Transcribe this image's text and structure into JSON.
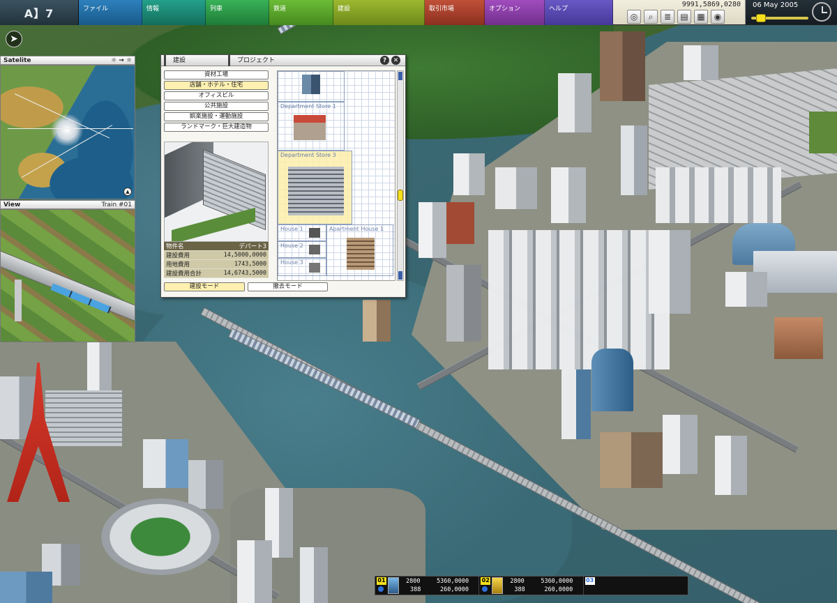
{
  "menubar": {
    "logo": "A】7",
    "items": [
      {
        "label": "ファイル",
        "color": "#1e6ea6"
      },
      {
        "label": "情報",
        "color": "#1a8a74"
      },
      {
        "label": "列車",
        "color": "#2c9c48"
      },
      {
        "label": "鉄道",
        "color": "#5aa82a"
      },
      {
        "label": "建設",
        "color": "#8aa624"
      },
      {
        "label": "取引市場",
        "color": "#a8432c"
      },
      {
        "label": "オプション",
        "color": "#8c3ea6"
      },
      {
        "label": "ヘルプ",
        "color": "#5a48b2"
      }
    ]
  },
  "status": {
    "money": "9991,5869,0280",
    "tools": [
      "planet-icon",
      "zoom-icon",
      "layers-icon",
      "stack-icon",
      "grid-layers-icon",
      "target-icon"
    ],
    "date": "06 May 2005",
    "speed_level": 0.1
  },
  "satellite": {
    "title": "Satelite"
  },
  "view": {
    "title": "View",
    "train": "Train #01"
  },
  "build_window": {
    "tabs": [
      "建設",
      "プロジェクト"
    ],
    "help": "?",
    "close": "✕",
    "categories": [
      {
        "label": "資材工場",
        "selected": false
      },
      {
        "label": "店舗・ホテル・住宅",
        "selected": true
      },
      {
        "label": "オフィスビル",
        "selected": false
      },
      {
        "label": "公共施設",
        "selected": false
      },
      {
        "label": "娯楽施設・運動施設",
        "selected": false
      },
      {
        "label": "ランドマーク・巨大建造物",
        "selected": false
      }
    ],
    "info": {
      "name_label": "物件名",
      "name_value": "デパート3",
      "rows": [
        {
          "label": "建設費用",
          "value": "14,5000,0000"
        },
        {
          "label": "用地費用",
          "value": "1743,5000"
        },
        {
          "label": "建設費用合計",
          "value": "14,6743,5000"
        }
      ]
    },
    "modes": {
      "build": "建設モード",
      "remove": "撤去モード"
    },
    "buildings": {
      "store1": "Department Store 1",
      "store3": "Department Store 3",
      "house1": "House 1",
      "house2": "House 2",
      "house3": "House 3",
      "apartment1": "Apartment House 1"
    }
  },
  "trains": [
    {
      "num": "01",
      "a": "2800",
      "b": "388",
      "c": "5360,0000",
      "d": "260,0000",
      "icon": "blue"
    },
    {
      "num": "02",
      "a": "2800",
      "b": "388",
      "c": "5360,0000",
      "d": "260,0000",
      "icon": "yellow"
    },
    {
      "num": "03",
      "a": "",
      "b": "",
      "c": "",
      "d": "",
      "icon": "none"
    }
  ]
}
